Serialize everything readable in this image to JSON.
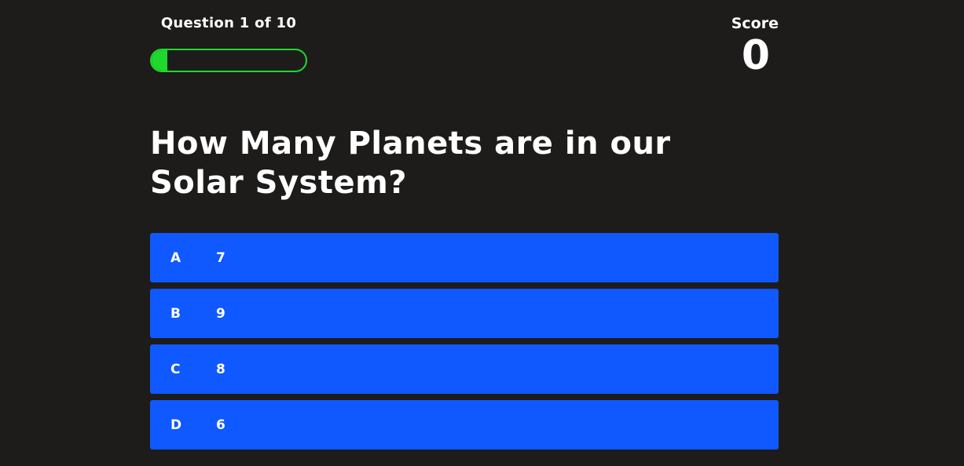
{
  "hud": {
    "progress_text": "Question 1 of 10",
    "progress_fraction": 0.1,
    "progress_color": "#1fd82e",
    "score_label": "Score",
    "score_value": "0"
  },
  "question": {
    "text": "How Many Planets are in our Solar System?"
  },
  "choices": [
    {
      "prefix": "A",
      "text": "7"
    },
    {
      "prefix": "B",
      "text": "9"
    },
    {
      "prefix": "C",
      "text": "8"
    },
    {
      "prefix": "D",
      "text": "6"
    }
  ],
  "colors": {
    "background": "#1d1c1b",
    "choice_background": "#1058ff",
    "text": "#ffffff"
  }
}
